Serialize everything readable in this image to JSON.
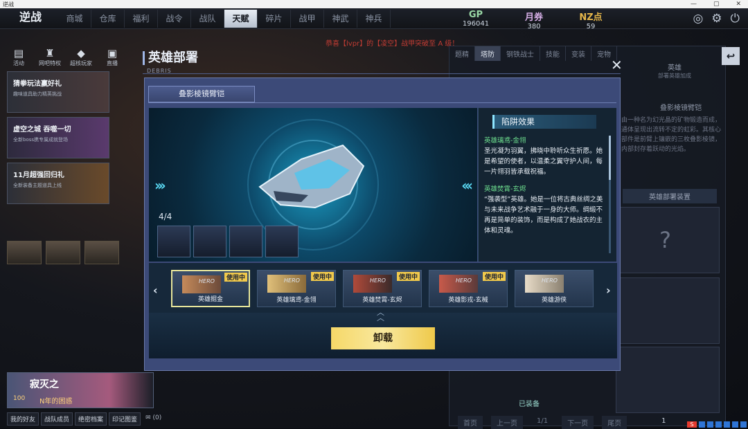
{
  "window": {
    "title": "逆战",
    "controls": [
      "—",
      "▢",
      "✕"
    ]
  },
  "logo": "逆战",
  "nav": {
    "tabs": [
      "商城",
      "仓库",
      "福利",
      "战令",
      "战队",
      "天赋",
      "碎片",
      "战甲",
      "神武",
      "神兵"
    ],
    "active_index": 5
  },
  "currency": [
    {
      "label": "GP",
      "value": "196041"
    },
    {
      "label": "月券",
      "value": "380"
    },
    {
      "label": "NZ点",
      "value": "59"
    }
  ],
  "ticker": "恭喜【lvpr】的【凌空】战甲突破至 A 级！",
  "left_rail": {
    "icons": [
      {
        "label": "活动",
        "icon": "calendar-icon"
      },
      {
        "label": "网吧特权",
        "icon": "trophy-icon"
      },
      {
        "label": "超核玩家",
        "icon": "diamond-icon"
      },
      {
        "label": "直播",
        "icon": "tv-icon"
      }
    ],
    "promos": [
      {
        "title": "猜拳玩法赢好礼",
        "subtitle": "趣味道具助力精英挑战"
      },
      {
        "title": "虚空之城 吞噬一切",
        "subtitle": "全新boss携专属成就登场"
      },
      {
        "title": "11月超强回归礼",
        "subtitle": "全新装备主题道具上线"
      }
    ]
  },
  "player": {
    "name": "寂灭之",
    "level": "100",
    "title": "N年的困惑"
  },
  "bottom_links": [
    "我的好友",
    "战队成员",
    "绝密档案",
    "印记图鉴"
  ],
  "mail_count": "(0)",
  "bg_panel": {
    "tabs": [
      "题精",
      "塔防",
      "钢铁战士",
      "技能",
      "变装",
      "宠物"
    ],
    "active_tab": 1,
    "hero_label": "英雄",
    "hero_sub": "部署英雄加成",
    "item_title": "叠影棱镜臂铠",
    "desc": "由一种名为幻光晶的矿物锻造而成，通体呈现出流转不定的虹彩。其核心部件是前臂上镶嵌的三枚叠影棱镜，内部封存着跃动的光焰。",
    "deploy_label": "英雄部署装置",
    "equipped": "已装备",
    "pager": [
      "首页",
      "上一页",
      "1/1",
      "下一页",
      "尾页"
    ],
    "page_number": "1"
  },
  "modal": {
    "title": "英雄部署",
    "subtitle": "DEBRIS",
    "tab": "叠影棱镜臂铠",
    "counter": "4/4",
    "effect_title": "陷阱效果",
    "effects": [
      {
        "name": "英雄璃鸢-金翎",
        "text": "圣光凝为羽翼，拂晓中聆听众生祈愿。她是希望的使者，以温柔之翼守护人间，每一片翎羽皆承载祝福。"
      },
      {
        "name": "英雄焚霄-玄烬",
        "text": "“强袭型”英雄。她是一位将古典丝绸之美与未来战争艺术融于一身的大师。绸缎不再是简单的装饰，而是构成了她战衣的主体和灵魂。"
      }
    ],
    "heroes": [
      {
        "name": "英雄掘金",
        "badge": "使用中",
        "selected": true
      },
      {
        "name": "英雄璃鸢-金翎",
        "badge": "使用中",
        "selected": false
      },
      {
        "name": "英雄焚霄-玄烬",
        "badge": "使用中",
        "selected": false
      },
      {
        "name": "英雄影戎-玄械",
        "badge": "使用中",
        "selected": false
      },
      {
        "name": "英雄游侠",
        "badge": "",
        "selected": false
      }
    ],
    "hero_tag": "HERO",
    "unload_label": "卸载"
  }
}
